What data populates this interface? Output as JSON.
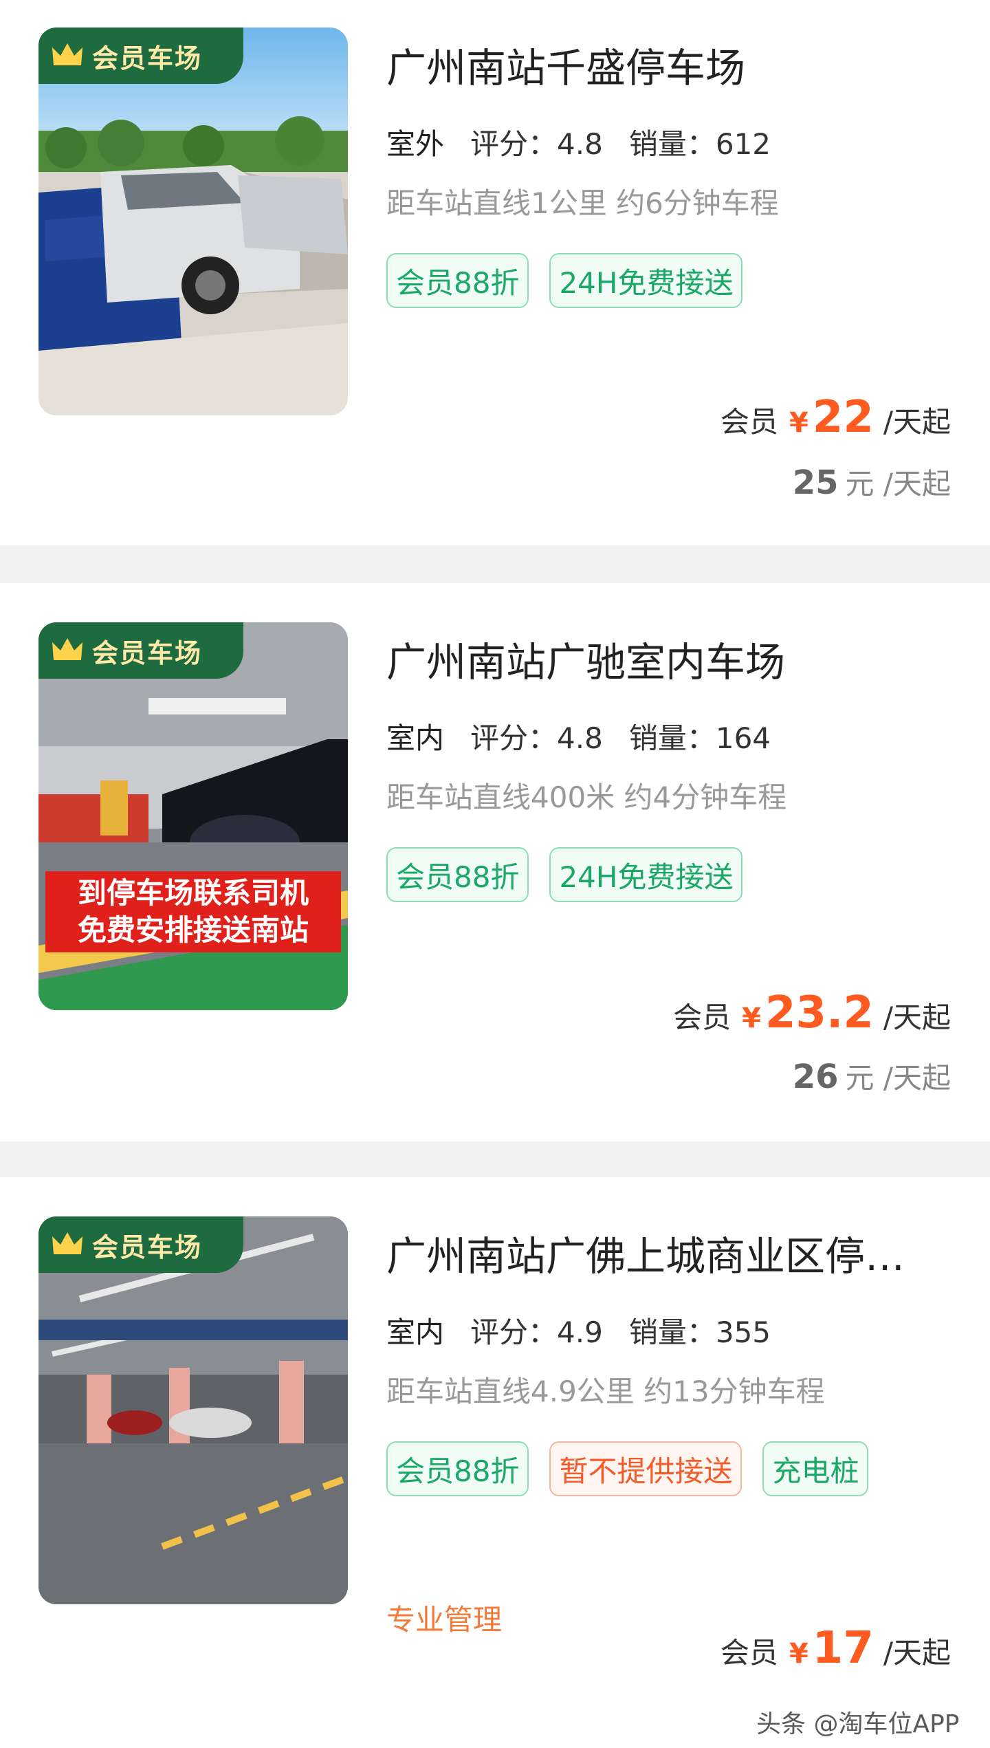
{
  "listings": [
    {
      "badge": "会员车场",
      "title": "广州南站千盛停车场",
      "kind": "室外",
      "rating_label": "评分：",
      "rating": "4.8",
      "sales_label": "销量：",
      "sales": "612",
      "distance": "距车站直线1公里 约6分钟车程",
      "tags": [
        "会员88折",
        "24H免费接送"
      ],
      "member_label": "会员",
      "currency": "¥",
      "member_price": "22",
      "price_unit": "/天起",
      "orig_price": "25",
      "orig_unit": "元 /天起"
    },
    {
      "badge": "会员车场",
      "title": "广州南站广驰室内车场",
      "kind": "室内",
      "rating_label": "评分：",
      "rating": "4.8",
      "sales_label": "销量：",
      "sales": "164",
      "distance": "距车站直线400米 约4分钟车程",
      "image_caption": [
        "到停车场联系司机",
        "免费安排接送南站"
      ],
      "tags": [
        "会员88折",
        "24H免费接送"
      ],
      "member_label": "会员",
      "currency": "¥",
      "member_price": "23.2",
      "price_unit": "/天起",
      "orig_price": "26",
      "orig_unit": "元 /天起"
    },
    {
      "badge": "会员车场",
      "title": "广州南站广佛上城商业区停…",
      "kind": "室内",
      "rating_label": "评分：",
      "rating": "4.9",
      "sales_label": "销量：",
      "sales": "355",
      "distance": "距车站直线4.9公里 约13分钟车程",
      "tags": [
        "会员88折",
        "暂不提供接送",
        "充电桩"
      ],
      "management": "专业管理",
      "member_label": "会员",
      "currency": "¥",
      "member_price": "17",
      "price_unit": "/天起"
    }
  ],
  "watermark": "头条 @淘车位APP",
  "colors": {
    "accent_green": "#1aa866",
    "price_orange": "#ff5a1f",
    "badge_bg": "#1e6b3f",
    "badge_text": "#ffe9a8"
  }
}
